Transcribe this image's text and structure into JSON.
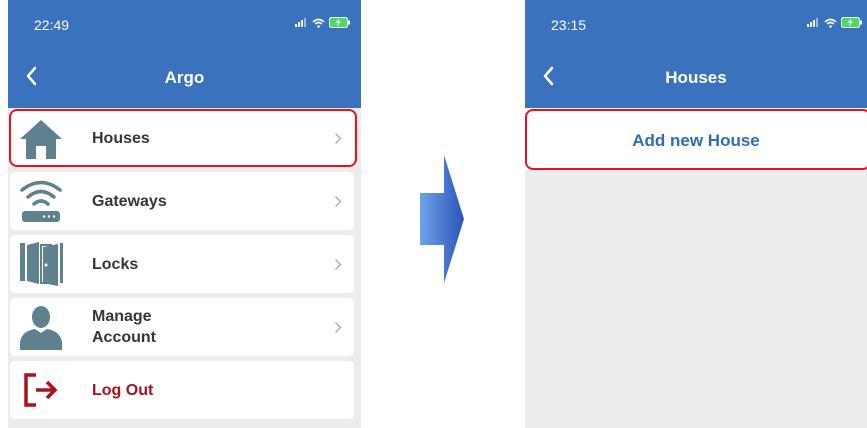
{
  "left_screen": {
    "status": {
      "time": "22:49"
    },
    "nav": {
      "title": "Argo"
    },
    "menu": [
      {
        "label": "Houses",
        "icon": "house-icon"
      },
      {
        "label": "Gateways",
        "icon": "wifi-router-icon"
      },
      {
        "label": "Locks",
        "icon": "door-icon"
      },
      {
        "label": "Manage\nAccount",
        "icon": "person-icon"
      },
      {
        "label": "Log Out",
        "icon": "logout-icon"
      }
    ]
  },
  "right_screen": {
    "status": {
      "time": "23:15"
    },
    "nav": {
      "title": "Houses"
    },
    "add_button": "Add new House"
  },
  "colors": {
    "nav_bar": "#3b72bd",
    "highlight": "#e8111f",
    "icon_slate": "#5e8190",
    "logout_red": "#a8121c",
    "link_blue": "#2f6bb8"
  }
}
